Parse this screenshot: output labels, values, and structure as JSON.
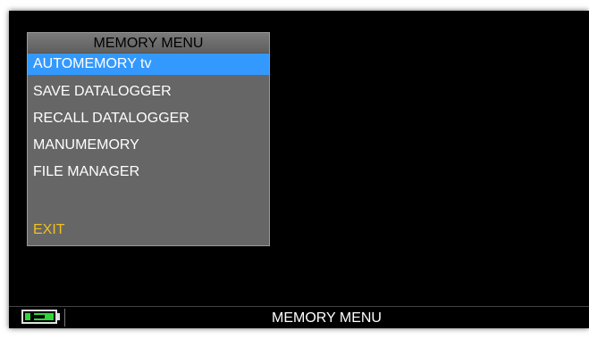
{
  "menu": {
    "title": "MEMORY MENU",
    "items": [
      {
        "label": "AUTOMEMORY tv",
        "selected": true
      },
      {
        "label": "SAVE DATALOGGER",
        "selected": false
      },
      {
        "label": "RECALL DATALOGGER",
        "selected": false
      },
      {
        "label": "MANUMEMORY",
        "selected": false
      },
      {
        "label": "FILE MANAGER",
        "selected": false
      }
    ],
    "exit_label": "EXIT"
  },
  "status_bar": {
    "title": "MEMORY MENU",
    "battery_icon": "battery-charging-icon",
    "battery_color": "#2ed63a"
  },
  "colors": {
    "selection": "#3399ff",
    "exit": "#f0c020",
    "menu_bg": "#666666",
    "screen_bg": "#000000"
  }
}
